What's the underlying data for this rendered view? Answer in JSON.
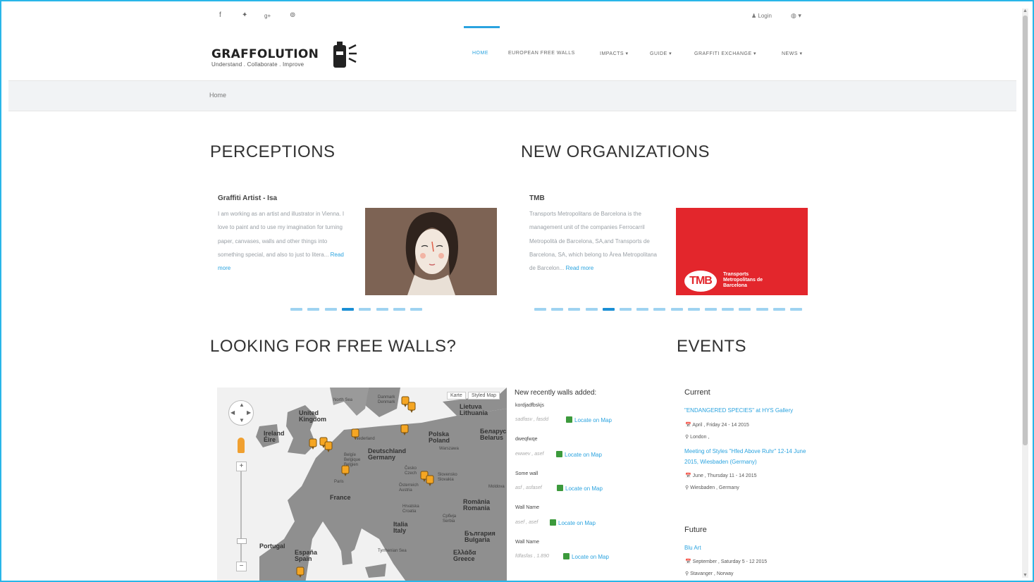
{
  "topbar": {
    "social": [
      {
        "name": "facebook",
        "glyph": "f"
      },
      {
        "name": "twitter",
        "glyph": "✦"
      },
      {
        "name": "google-plus",
        "glyph": "g+"
      },
      {
        "name": "pinterest",
        "glyph": "⊚"
      }
    ],
    "login_label": "Login",
    "language_glyph": "◍ ▾"
  },
  "header": {
    "logo_name": "GRAFFOLUTION",
    "logo_tagline": "Understand . Collaborate . Improve",
    "nav": [
      {
        "label": "HOME",
        "active": true
      },
      {
        "label": "EUROPEAN FREE WALLS"
      },
      {
        "label": "IMPACTS ▾"
      },
      {
        "label": "GUIDE ▾"
      },
      {
        "label": "GRAFFITI EXCHANGE ▾"
      },
      {
        "label": "NEWS ▾"
      }
    ]
  },
  "breadcrumb": {
    "home": "Home"
  },
  "perceptions": {
    "title": "PERCEPTIONS",
    "card_title": "Graffiti Artist - Isa",
    "card_text": "I am working as an artist and illustrator in Vienna. I love to paint and to use my imagination for turning paper, canvases, walls and other things into something special, and also to just to litera... ",
    "read_more": "Read more",
    "dots": {
      "count": 8,
      "active": 3
    }
  },
  "organizations": {
    "title": "NEW ORGANIZATIONS",
    "card_title": "TMB",
    "card_text": "Transports Metropolitans de Barcelona is the management unit of the companies Ferrocarril Metropolità de Barcelona, SA,and Transports de Barcelona, SA, which belong to Àrea Metropolitana de Barcelon... ",
    "read_more": "Read more",
    "logo_mark": "TMB",
    "logo_text": "Transports Metropolitans de Barcelona",
    "dots": {
      "count": 16,
      "active": 4
    }
  },
  "free_walls": {
    "title": "LOOKING FOR FREE WALLS?",
    "map_buttons": [
      "Karte",
      "Styled Map"
    ],
    "map_labels": {
      "united_kingdom": "United\nKingdom",
      "ireland": "Ireland\nÉire",
      "nederland": "Nederland",
      "belgie": "Belgïe\nBelgique\nBelgien",
      "deutschland": "Deutschland\nGermany",
      "polska": "Polska\nPoland",
      "lietuva": "Lietuva\nLithuania",
      "belarus": "Беларусь\nBelarus",
      "france": "France",
      "paris": "Paris",
      "cesko": "Česko\nCzech",
      "slovensko": "Slovensko\nSlovakia",
      "osterreich": "Österreich\nAustria",
      "hrvatska": "Hrvatska\nCroatia",
      "srbija": "Србија\nSerbia",
      "romania": "România\nRomania",
      "bulgaria": "България\nBulgaria",
      "italia": "Italia\nItaly",
      "portugal": "Portugal",
      "espana": "España\nSpain",
      "ellada": "Ελλάδα\nGreece",
      "moldova": "Moldova",
      "danmark": "Danmark\nDenmark",
      "warszawa": "Warszawa",
      "north_sea": "North Sea",
      "tyrrhenian": "Tyrrhenian Sea"
    },
    "walls_heading": "New recently walls added:",
    "walls": [
      {
        "name": "kordjadfbskjs",
        "coords": "sadfasv , fasdd",
        "link": "Locate on Map"
      },
      {
        "name": "dweqfwqe",
        "coords": "ewwev , asef",
        "link": "Locate on Map"
      },
      {
        "name": "Some wall",
        "coords": "asf , asfasef",
        "link": "Locate on Map"
      },
      {
        "name": "Wall Name",
        "coords": "asef , asef",
        "link": "Locate on Map"
      },
      {
        "name": "Wall Name",
        "coords": "fdfasfas , 1.890",
        "link": "Locate on Map"
      }
    ]
  },
  "events": {
    "title": "EVENTS",
    "current_label": "Current",
    "future_label": "Future",
    "current": [
      {
        "title": "\"ENDANGERED SPECIES\" at HYS Gallery",
        "date": "April , Friday 24 - 14 2015",
        "place": "London ,"
      },
      {
        "title": "Meeting of Styles \"Hfed Above Ruhr\" 12-14 June 2015, Wiesbaden (Germany)",
        "date": "June , Thursday 11 - 14 2015",
        "place": "Wiesbaden , Germany"
      }
    ],
    "future": [
      {
        "title": "Blu Art",
        "date": "September , Saturday 5 - 12 2015",
        "place": "Stavanger , Norway"
      }
    ]
  },
  "colors": {
    "accent": "#2aa3df",
    "frame": "#29b6e8",
    "tmb_red": "#e3262c"
  }
}
